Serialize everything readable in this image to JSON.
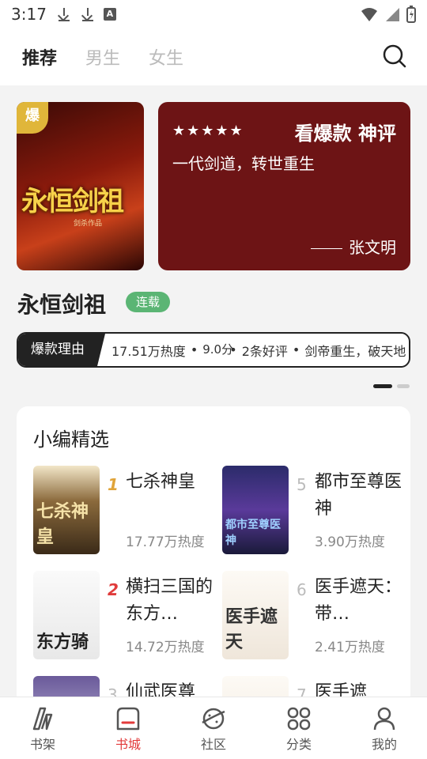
{
  "status_bar": {
    "time": "3:17"
  },
  "top_tabs": [
    {
      "label": "推荐",
      "active": true
    },
    {
      "label": "男生",
      "active": false
    },
    {
      "label": "女生",
      "active": false
    }
  ],
  "feature": {
    "cover_badge": "爆",
    "cover_title": "永恒剑祖",
    "cover_author": "剑杀作品",
    "stars": "★★★★★",
    "review_heading": "看爆款 神评",
    "review_text": "一代剑道，转世重生",
    "review_author": "张文明",
    "book_title": "永恒剑祖",
    "status_badge": "连载",
    "reason_tag": "爆款理由",
    "heat": "17.51万热度",
    "score": "9.0分",
    "reviews": "2条好评",
    "summary": "剑帝重生，破天地"
  },
  "picks": {
    "title": "小编精选",
    "items": [
      {
        "rank": "1",
        "name": "七杀神皇",
        "heat": "17.77万热度",
        "cover_text": "七杀神皇"
      },
      {
        "rank": "5",
        "name": "都市至尊医神",
        "heat": "3.90万热度",
        "cover_text": "都市至尊医神"
      },
      {
        "rank": "2",
        "name": "横扫三国的东方…",
        "heat": "14.72万热度",
        "cover_text": "东方骑"
      },
      {
        "rank": "6",
        "name": "医手遮天：带…",
        "heat": "2.41万热度",
        "cover_text": "医手遮天"
      },
      {
        "rank": "3",
        "name": "仙武医尊",
        "heat": "",
        "cover_text": ""
      },
      {
        "rank": "7",
        "name": "医手遮",
        "heat": "",
        "cover_text": ""
      }
    ]
  },
  "bottom_nav": [
    {
      "label": "书架",
      "icon": "bookshelf-icon",
      "active": false
    },
    {
      "label": "书城",
      "icon": "bookstore-icon",
      "active": true
    },
    {
      "label": "社区",
      "icon": "community-icon",
      "active": false
    },
    {
      "label": "分类",
      "icon": "category-icon",
      "active": false
    },
    {
      "label": "我的",
      "icon": "profile-icon",
      "active": false
    }
  ],
  "colors": {
    "accent": "#e23a3a",
    "review_card": "#6d1415",
    "serial_badge": "#5bb574"
  }
}
